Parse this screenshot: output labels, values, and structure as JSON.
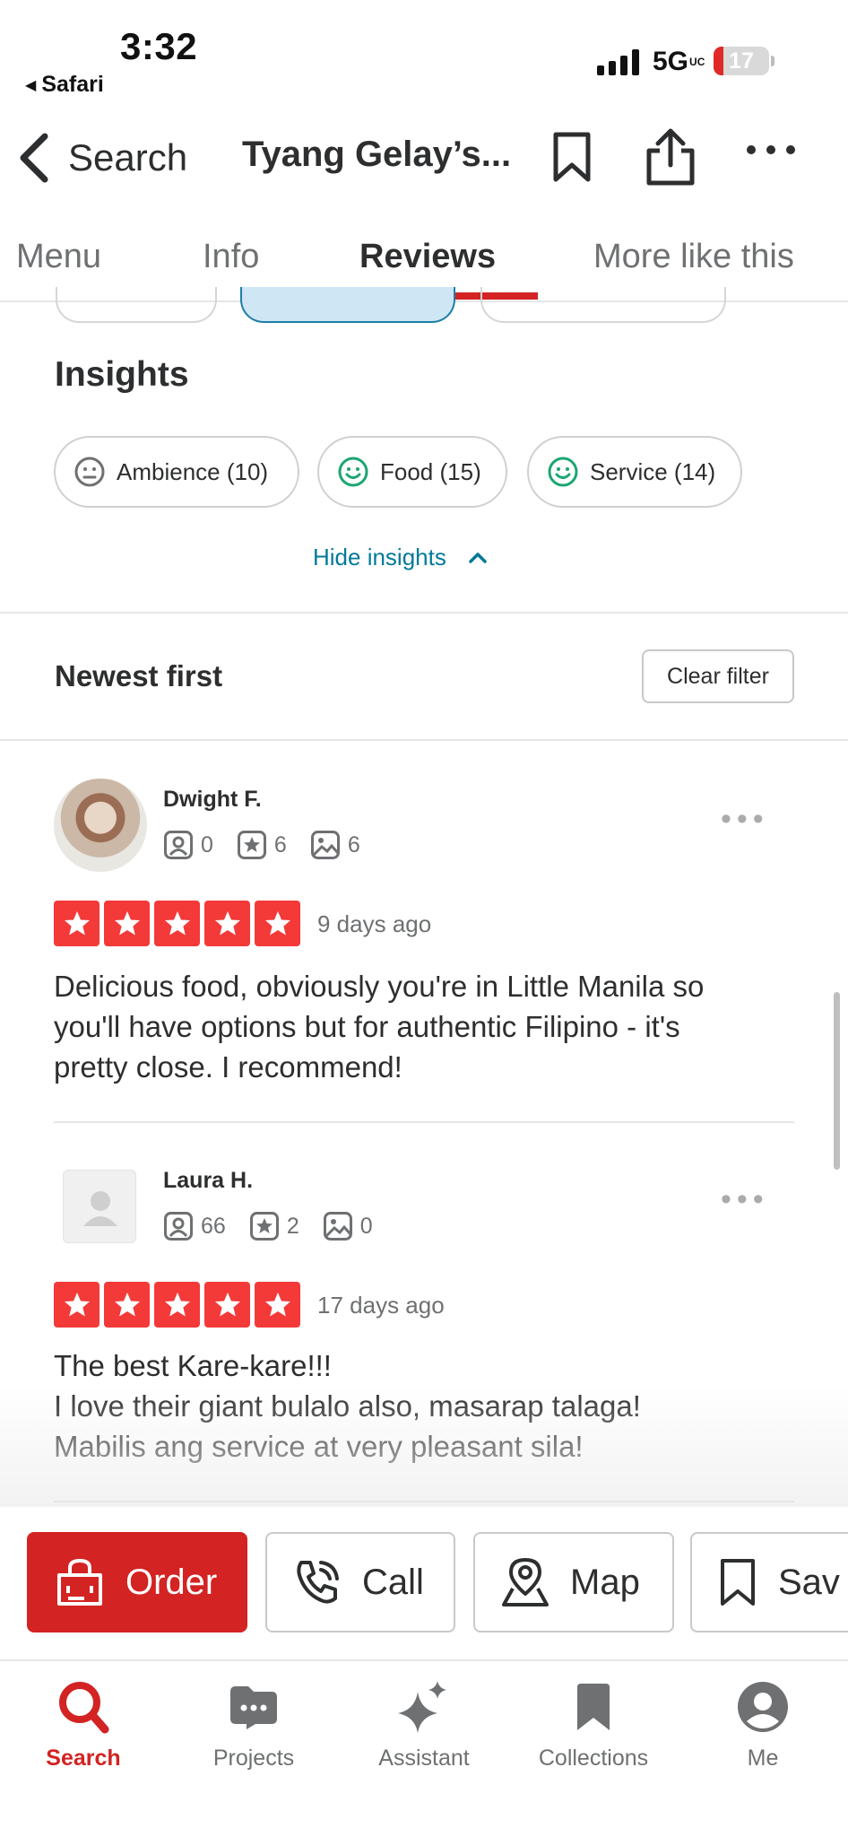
{
  "status_bar": {
    "time": "3:32",
    "back_app": "Safari",
    "network": "5G",
    "network_badge": "UC",
    "battery": "17",
    "battery_level": 0.17
  },
  "header": {
    "back_label": "Search",
    "title": "Tyang Gelay’s...",
    "icons": [
      "bookmark-icon",
      "share-icon",
      "more-icon"
    ]
  },
  "tabs": [
    {
      "label": "Menu",
      "active": false
    },
    {
      "label": "Info",
      "active": false
    },
    {
      "label": "Reviews",
      "active": true
    },
    {
      "label": "More like this",
      "active": false
    }
  ],
  "insights": {
    "title": "Insights",
    "pills": [
      {
        "label": "Ambience (10)",
        "icon": "neutral-face-icon",
        "color": "#6e7072"
      },
      {
        "label": "Food (15)",
        "icon": "smiley-face-icon",
        "color": "#1ca672"
      },
      {
        "label": "Service (14)",
        "icon": "smiley-face-icon",
        "color": "#1ca672"
      }
    ],
    "toggle_label": "Hide insights"
  },
  "sort": {
    "label": "Newest first",
    "clear_label": "Clear filter"
  },
  "reviews": [
    {
      "name": "Dwight F.",
      "friends": "0",
      "reviews": "6",
      "photos": "6",
      "rating": 5,
      "ago": "9 days ago",
      "text": "Delicious food, obviously you're in Little Manila so\nyou'll have options but for authentic Filipino - it's\npretty close. I recommend!"
    },
    {
      "name": "Laura H.",
      "friends": "66",
      "reviews": "2",
      "photos": "0",
      "rating": 5,
      "ago": "17 days ago",
      "text": "The best Kare-kare!!!\nI love their giant bulalo also, masarap talaga!\nMabilis ang service at very pleasant sila!"
    }
  ],
  "actions": [
    {
      "label": "Order",
      "icon": "shopping-bag-icon",
      "primary": true
    },
    {
      "label": "Call",
      "icon": "phone-icon",
      "primary": false
    },
    {
      "label": "Map",
      "icon": "map-pin-icon",
      "primary": false
    },
    {
      "label": "Sav",
      "icon": "bookmark-icon",
      "primary": false
    }
  ],
  "tabbar": [
    {
      "label": "Search",
      "icon": "search-icon",
      "active": true
    },
    {
      "label": "Projects",
      "icon": "projects-icon",
      "active": false
    },
    {
      "label": "Assistant",
      "icon": "sparkle-icon",
      "active": false
    },
    {
      "label": "Collections",
      "icon": "collections-icon",
      "active": false
    },
    {
      "label": "Me",
      "icon": "profile-icon",
      "active": false
    }
  ],
  "colors": {
    "brand_red": "#d32323",
    "star_red": "#f43939",
    "link_teal": "#027a97",
    "positive_green": "#1ca672"
  }
}
